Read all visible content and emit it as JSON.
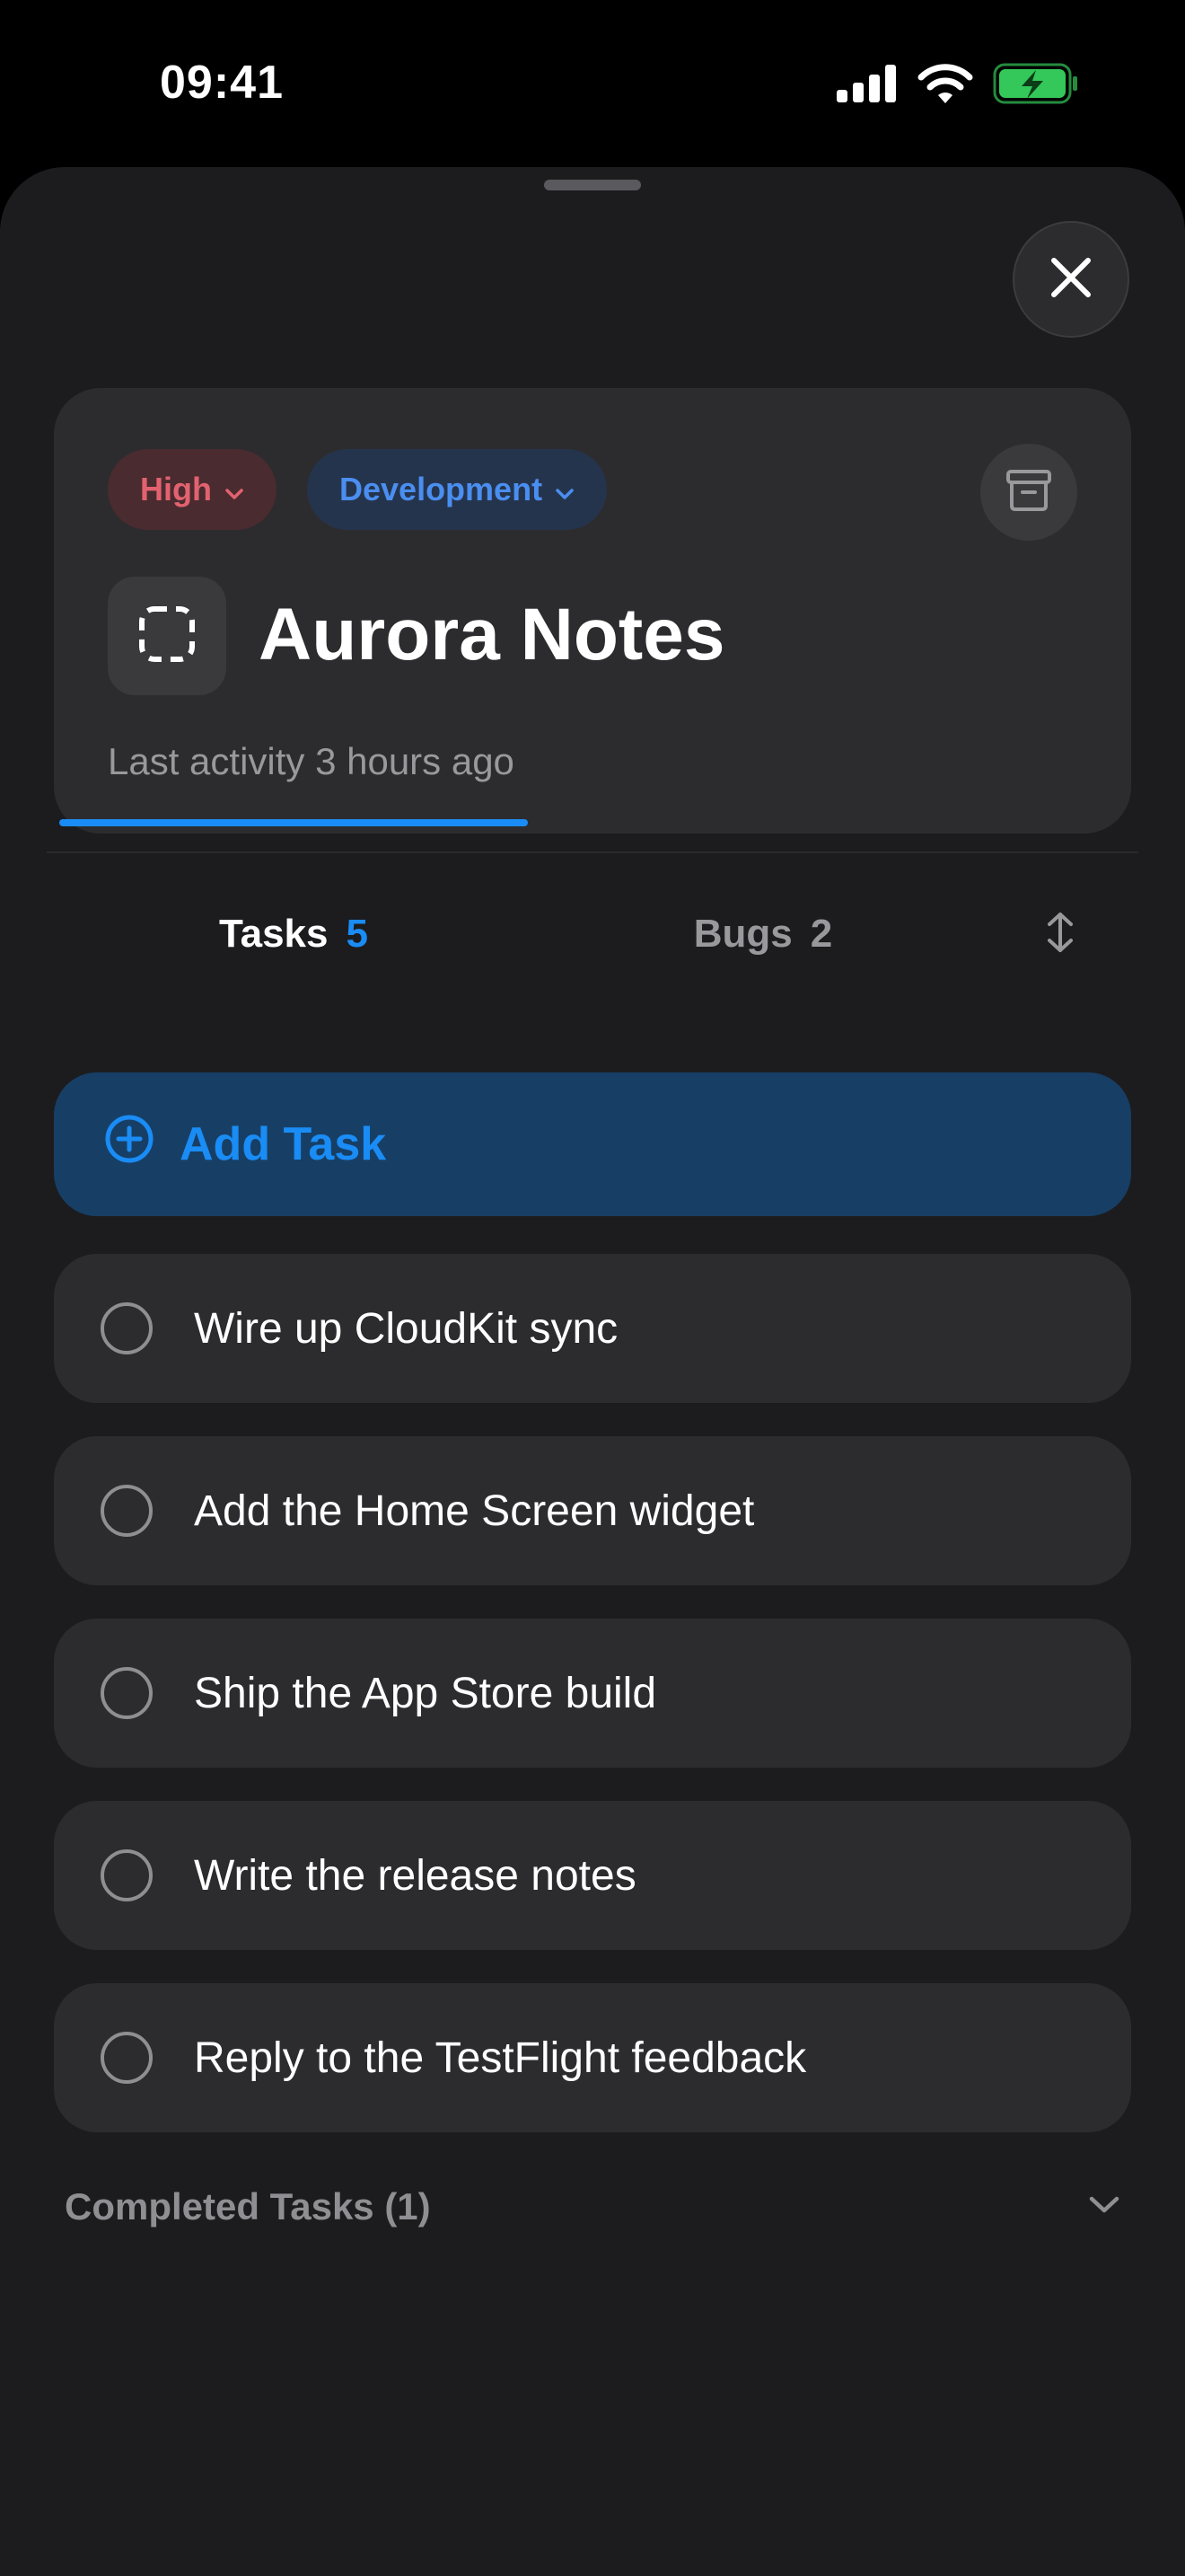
{
  "status_bar": {
    "time": "09:41",
    "icons": [
      "cellular-signal-icon",
      "wifi-icon",
      "battery-charging-icon"
    ]
  },
  "sheet": {
    "close_icon": "close-icon"
  },
  "project": {
    "priority_label": "High",
    "category_label": "Development",
    "title": "Aurora Notes",
    "last_activity": "Last activity 3 hours ago",
    "archive_icon": "archive-icon",
    "project_icon": "dashed-square-icon"
  },
  "tabs": {
    "tasks_label": "Tasks",
    "tasks_count": "5",
    "bugs_label": "Bugs",
    "bugs_count": "2",
    "selected": "Tasks",
    "sort_icon": "sort-icon"
  },
  "add_task": {
    "label": "Add Task",
    "icon": "plus-circle-icon"
  },
  "tasks": [
    {
      "title": "Wire up CloudKit sync",
      "done": false
    },
    {
      "title": "Add the Home Screen widget",
      "done": false
    },
    {
      "title": "Ship the App Store build",
      "done": false
    },
    {
      "title": "Write the release notes",
      "done": false
    },
    {
      "title": "Reply to the TestFlight feedback",
      "done": false
    }
  ],
  "completed": {
    "label": "Completed Tasks (1)",
    "icon": "chevron-down-icon"
  },
  "colors": {
    "accent": "#1a8cf5",
    "priority_high": "#e26270",
    "category": "#4a8ef0",
    "battery": "#34c759"
  }
}
